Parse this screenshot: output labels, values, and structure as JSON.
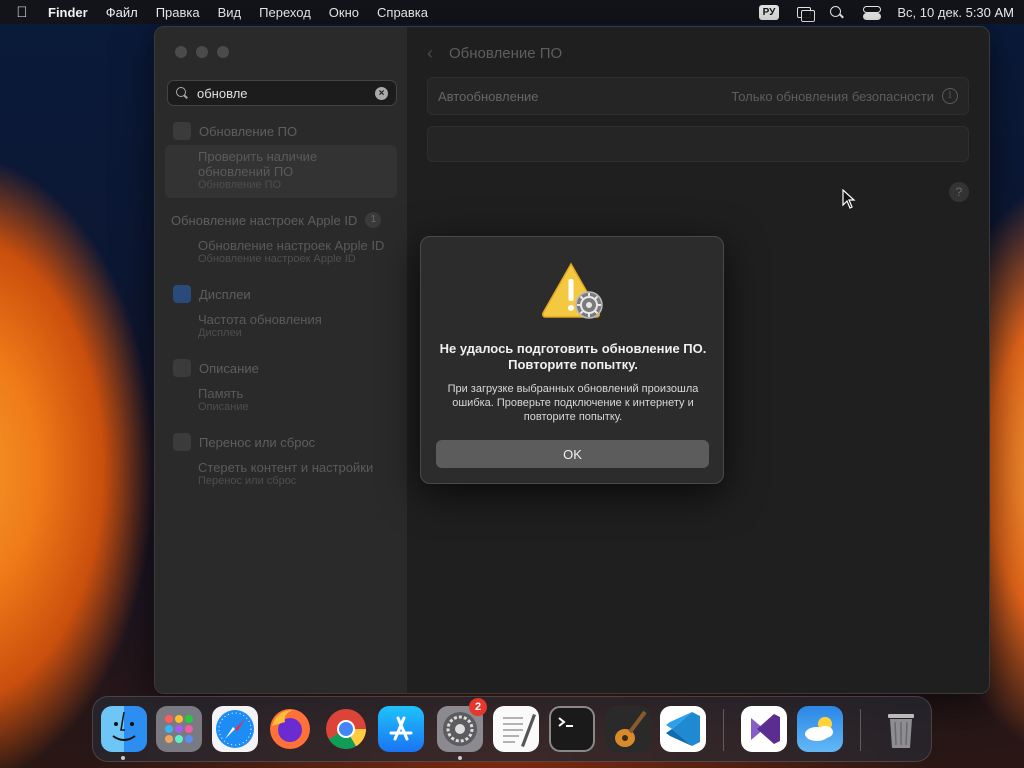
{
  "menubar": {
    "items": [
      "Finder",
      "Файл",
      "Правка",
      "Вид",
      "Переход",
      "Окно",
      "Справка"
    ],
    "lang": "РУ",
    "datetime": "Вс, 10 дек. 5:30 AM"
  },
  "settings": {
    "search_value": "обновле",
    "sidebar_groups": [
      {
        "title": "Обновление ПО",
        "results": [
          {
            "title": "Проверить наличие обновлений ПО",
            "sub": "Обновление ПО"
          }
        ]
      },
      {
        "title": "Обновление настроек Apple ID",
        "badge": "1",
        "results": [
          {
            "title": "Обновление настроек Apple ID",
            "sub": "Обновление настроек Apple ID"
          }
        ]
      },
      {
        "title": "Дисплеи",
        "results": [
          {
            "title": "Частота обновления",
            "sub": "Дисплеи"
          }
        ]
      },
      {
        "title": "Описание",
        "results": [
          {
            "title": "Память",
            "sub": "Описание"
          }
        ]
      },
      {
        "title": "Перенос или сброс",
        "results": [
          {
            "title": "Стереть контент и настройки",
            "sub": "Перенос или сброс"
          }
        ]
      }
    ],
    "content_title": "Обновление ПО",
    "auto_update_label": "Автообновление",
    "auto_update_value": "Только обновления безопасности",
    "help_label": "?"
  },
  "dialog": {
    "title": "Не удалось подготовить обновление ПО. Повторите попытку.",
    "message": "При загрузке выбранных обновлений произошла ошибка. Проверьте подключение к интернету и повторите попытку.",
    "ok_label": "OK"
  },
  "dock": {
    "items": [
      "finder-icon",
      "launchpad-icon",
      "safari-icon",
      "firefox-icon",
      "chrome-icon",
      "app-store-icon",
      "system-settings-icon",
      "textedit-icon",
      "terminal-icon",
      "garageband-icon",
      "vscode-icon",
      "visual-studio-icon",
      "weather-icon",
      "trash-icon"
    ],
    "settings_badge": "2"
  }
}
